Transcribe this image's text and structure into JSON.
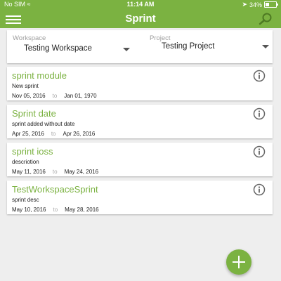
{
  "status_bar": {
    "carrier": "No SIM",
    "time": "11:14 AM",
    "battery": "34%"
  },
  "app_bar": {
    "title": "Sprint",
    "menu_icon": "hamburger-menu-icon",
    "search_icon": "search-icon"
  },
  "selector": {
    "workspace_label": "Workspace",
    "workspace_value": "Testing Workspace",
    "project_label": "Project",
    "project_value": "Testing Project"
  },
  "sprints": [
    {
      "name": "sprint module",
      "description": "New sprint",
      "start": "Nov 05, 2016",
      "to": "to",
      "end": "Jan 01, 1970"
    },
    {
      "name": "Sprint date",
      "description": "sprint added without date",
      "start": "Apr 25, 2016",
      "to": "to",
      "end": "Apr 26, 2016"
    },
    {
      "name": "sprint ioss",
      "description": "descriotion",
      "start": "May 11, 2016",
      "to": "to",
      "end": "May 24, 2016"
    },
    {
      "name": "TestWorkspaceSprint",
      "description": "sprint desc",
      "start": "May 10, 2016",
      "to": "to",
      "end": "May 28, 2016"
    }
  ],
  "colors": {
    "accent": "#7bb241",
    "background": "#eeeeee"
  }
}
